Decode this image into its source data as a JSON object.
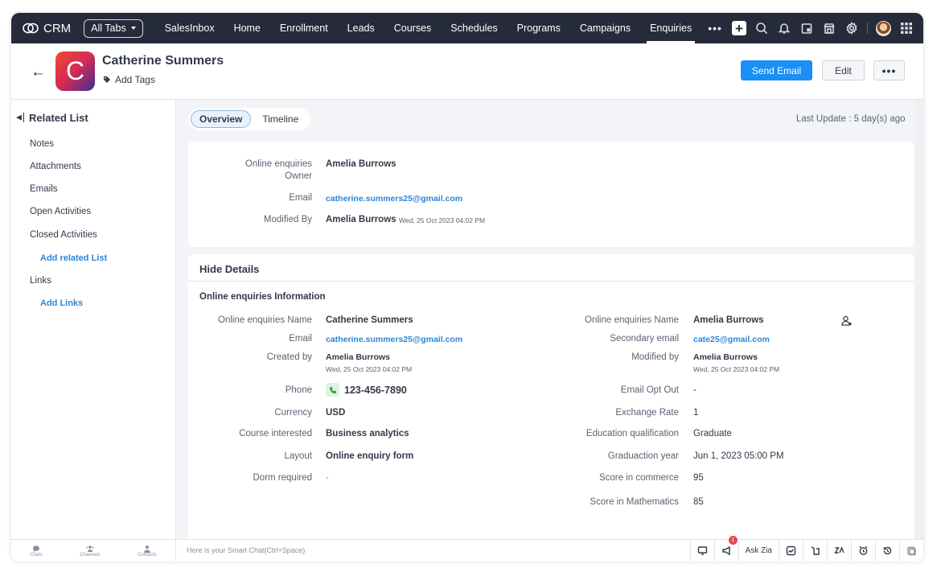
{
  "topbar": {
    "app_name": "CRM",
    "all_tabs_label": "All Tabs",
    "tabs": [
      {
        "label": "SalesInbox",
        "active": false
      },
      {
        "label": "Home",
        "active": false
      },
      {
        "label": "Enrollment",
        "active": false
      },
      {
        "label": "Leads",
        "active": false
      },
      {
        "label": "Courses",
        "active": false
      },
      {
        "label": "Schedules",
        "active": false
      },
      {
        "label": "Programs",
        "active": false
      },
      {
        "label": "Campaigns",
        "active": false
      },
      {
        "label": "Enquiries",
        "active": true
      }
    ],
    "more_label": "•••",
    "icons": [
      "plus-icon",
      "search-icon",
      "bell-icon",
      "calendar-icon",
      "marketplace-icon",
      "gear-icon",
      "user-avatar",
      "apps-grid-icon"
    ]
  },
  "record": {
    "avatar_letter": "C",
    "name": "Catherine Summers",
    "add_tags_label": "Add Tags",
    "send_email_label": "Send Email",
    "edit_label": "Edit",
    "more_label": "•••"
  },
  "sidebar": {
    "title": "Related List",
    "items": [
      "Notes",
      "Attachments",
      "Emails",
      "Open Activities",
      "Closed Activities"
    ],
    "add_related_list_label": "Add related List",
    "links_label": "Links",
    "add_links_label": "Add Links"
  },
  "main": {
    "tabs": [
      {
        "label": "Overview",
        "active": true
      },
      {
        "label": "Timeline",
        "active": false
      }
    ],
    "last_update": "Last Update : 5 day(s) ago",
    "overview": {
      "owner_label_line1": "Online enquiries",
      "owner_label_line2": "Owner",
      "owner_value": "Amelia Burrows",
      "email_label": "Email",
      "email_value": "catherine.summers25@gmail.com",
      "modified_label": "Modified By",
      "modified_value": "Amelia Burrows",
      "modified_time": "Wed, 25 Oct 2023 04:02 PM"
    },
    "details": {
      "hide_label": "Hide Details",
      "section_title": "Online enquiries Information",
      "left": [
        {
          "label": "Online enquiries Name",
          "value": "Catherine Summers"
        },
        {
          "label": "Email",
          "value": "catherine.summers25@gmail.com"
        },
        {
          "label": "Created by",
          "value": "Amelia Burrows",
          "sub": "Wed, 25 Oct 2023 04:02 PM"
        },
        {
          "label": "Phone",
          "value": "123-456-7890"
        },
        {
          "label": "Currency",
          "value": "USD"
        },
        {
          "label": "Course interested",
          "value": "Business analytics"
        },
        {
          "label": "Layout",
          "value": "Online enquiry form"
        },
        {
          "label": "Dorm required",
          "value": "-"
        }
      ],
      "right": [
        {
          "label": "Online enquiries Name",
          "value": "Amelia Burrows"
        },
        {
          "label": "Secondary email",
          "value": "cate25@gmail.com"
        },
        {
          "label": "Modified by",
          "value": "Amelia Burrows",
          "sub": "Wed, 25 Oct 2023 04:02 PM"
        },
        {
          "label": "Email Opt Out",
          "value": "-"
        },
        {
          "label": "Exchange Rate",
          "value": "1"
        },
        {
          "label": "Education qualification",
          "value": "Graduate"
        },
        {
          "label": "Graduaction year",
          "value": "Jun 1, 2023 05:00 PM"
        },
        {
          "label": "Score in commerce",
          "value": "95"
        },
        {
          "label": "Score in Mathematics",
          "value": "85"
        }
      ]
    }
  },
  "bottombar": {
    "chats_label": "Chats",
    "channels_label": "Channels",
    "contacts_label": "Contacts",
    "smart_chat_placeholder": "Here is your Smart Chat(Ctrl+Space)",
    "ask_zia_label": "Ask Zia",
    "notification_count": "1"
  },
  "colors": {
    "topbar_bg": "#252b3a",
    "primary_button": "#1a8ff5",
    "link": "#2b86d9",
    "page_bg": "#f3f4f8"
  }
}
